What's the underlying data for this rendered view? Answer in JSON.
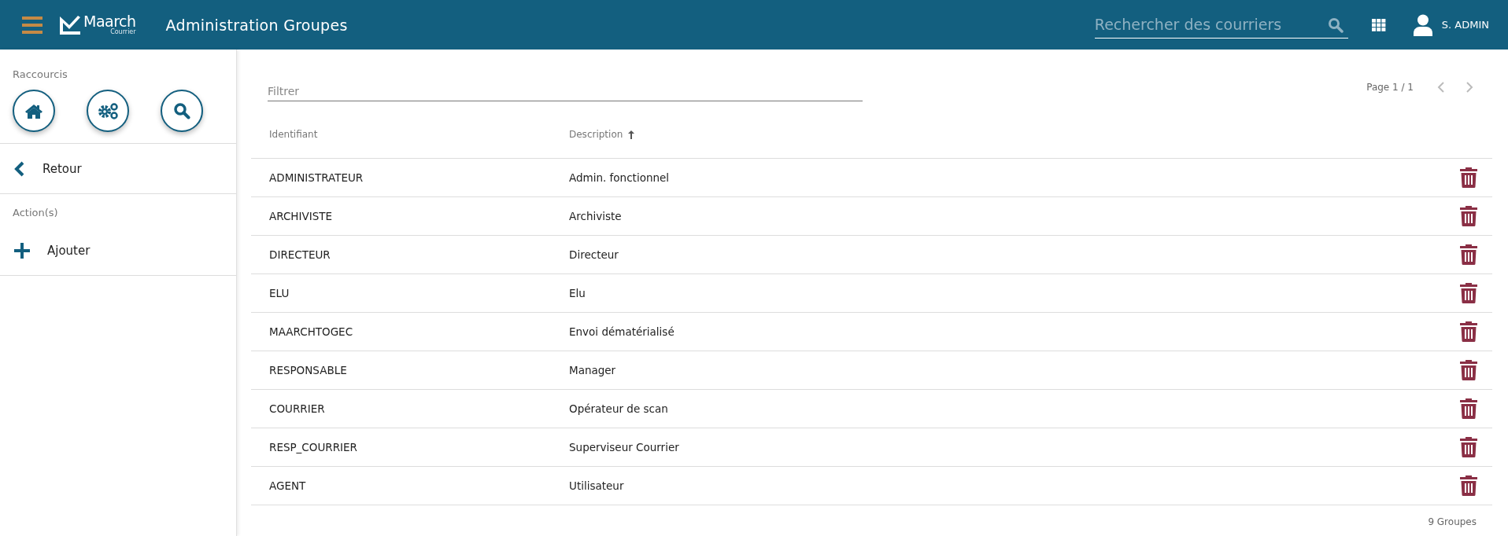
{
  "header": {
    "app_name": "Maarch",
    "app_subtitle": "Courrier",
    "title": "Administration Groupes",
    "search": {
      "placeholder": "Rechercher des courriers"
    },
    "user": "S. ADMIN"
  },
  "sidebar": {
    "shortcuts_title": "Raccourcis",
    "back": "Retour",
    "actions_title": "Action(s)",
    "actions": [
      "Ajouter"
    ]
  },
  "filter": {
    "placeholder": "Filtrer"
  },
  "pagination": {
    "label": "Page 1 / 1"
  },
  "table": {
    "columns": [
      {
        "label": "Identifiant",
        "sorted": false
      },
      {
        "label": "Description",
        "sorted": true
      }
    ],
    "rows": [
      {
        "id": "ADMINISTRATEUR",
        "description": "Admin. fonctionnel"
      },
      {
        "id": "ARCHIVISTE",
        "description": "Archiviste"
      },
      {
        "id": "DIRECTEUR",
        "description": "Directeur"
      },
      {
        "id": "ELU",
        "description": "Elu"
      },
      {
        "id": "MAARCHTOGEC",
        "description": "Envoi dématérialisé"
      },
      {
        "id": "RESPONSABLE",
        "description": "Manager"
      },
      {
        "id": "COURRIER",
        "description": "Opérateur de scan"
      },
      {
        "id": "RESP_COURRIER",
        "description": "Superviseur Courrier"
      },
      {
        "id": "AGENT",
        "description": "Utilisateur"
      }
    ]
  },
  "footer": {
    "count": "9 Groupes"
  }
}
